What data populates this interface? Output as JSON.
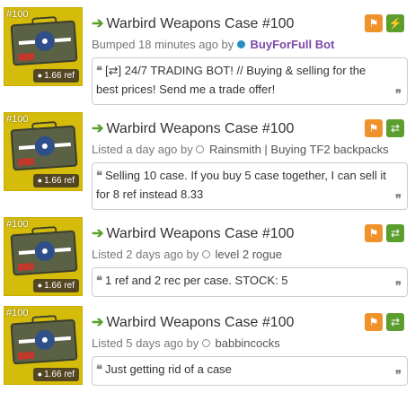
{
  "listings": [
    {
      "item_tag": "#100",
      "price": "1.66 ref",
      "title": "Warbird Weapons Case #100",
      "meta_prefix": "Bumped 18 minutes ago by",
      "user": "BuyForFull Bot",
      "user_status": "online",
      "comment": "[⇄] 24/7 TRADING BOT! // Buying & selling for the best prices! Send me a trade offer!",
      "right_button_icon": "lightning-icon"
    },
    {
      "item_tag": "#100",
      "price": "1.66 ref",
      "title": "Warbird Weapons Case #100",
      "meta_prefix": "Listed a day ago by",
      "user": "Rainsmith | Buying TF2 backpacks",
      "user_status": "offline",
      "comment": "Selling 10 case. If you buy 5 case together, I can sell it for 8 ref instead 8.33",
      "right_button_icon": "exchange-icon"
    },
    {
      "item_tag": "#100",
      "price": "1.66 ref",
      "title": "Warbird Weapons Case #100",
      "meta_prefix": "Listed 2 days ago by",
      "user": "level 2 rogue",
      "user_status": "offline",
      "comment": "1 ref and 2 rec per case. STOCK: 5",
      "right_button_icon": "exchange-icon"
    },
    {
      "item_tag": "#100",
      "price": "1.66 ref",
      "title": "Warbird Weapons Case #100",
      "meta_prefix": "Listed 5 days ago by",
      "user": "babbincocks",
      "user_status": "offline",
      "comment": "Just getting rid of a case",
      "right_button_icon": "exchange-icon"
    }
  ],
  "icons": {
    "flag": "⚑",
    "lightning": "⚡",
    "exchange": "⇄",
    "title_arrow": "➔",
    "price_tag": "🏷",
    "quote_open": "❝",
    "quote_close": "❞"
  },
  "colors": {
    "item_background": "#d6bc0a",
    "title_arrow": "#5aa02c",
    "flag_button": "#f0922c",
    "action_button": "#5c9e2e",
    "bot_user": "#7b49a8",
    "online_dot": "#2a8ec6"
  }
}
